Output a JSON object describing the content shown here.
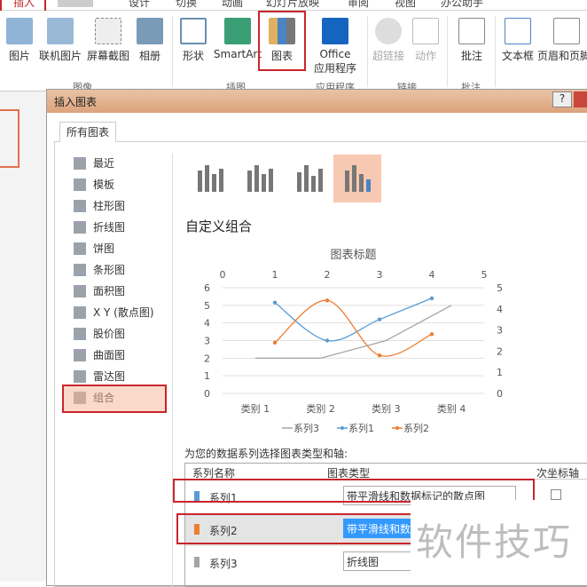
{
  "ribbon_tabs": [
    "插入",
    "设计",
    "切换",
    "动画",
    "幻灯片放映",
    "审阅",
    "视图",
    "办公助手"
  ],
  "ribbon_buttons": [
    "图片",
    "联机图片",
    "屏幕截图",
    "相册",
    "形状",
    "SmartArt",
    "图表",
    "Office\n应用程序",
    "超链接",
    "动作",
    "批注",
    "文本框",
    "页眉和页脚"
  ],
  "ribbon_groups": [
    "图像",
    "插图",
    "应用程序",
    "链接",
    "批注"
  ],
  "dialog": {
    "title": "插入图表",
    "help": "?",
    "tab": "所有图表",
    "categories": [
      "最近",
      "模板",
      "柱形图",
      "折线图",
      "饼图",
      "条形图",
      "面积图",
      "X Y (散点图)",
      "股价图",
      "曲面图",
      "雷达图",
      "组合"
    ],
    "selected_category": "组合",
    "heading": "自定义组合",
    "series_prompt": "为您的数据系列选择图表类型和轴:",
    "table_headers": [
      "系列名称",
      "图表类型",
      "次坐标轴"
    ],
    "rows": [
      {
        "name": "系列1",
        "type": "带平滑线和数据标记的散点图",
        "color": "#5b9bd5"
      },
      {
        "name": "系列2",
        "type": "带平滑线和数",
        "color": "#ed7d31"
      },
      {
        "name": "系列3",
        "type": "折线图",
        "color": "#a5a5a5"
      }
    ]
  },
  "watermark": "软件技巧",
  "chart_data": {
    "type": "combo",
    "title": "图表标题",
    "categories": [
      "类别 1",
      "类别 2",
      "类别 3",
      "类别 4"
    ],
    "left_axis": {
      "range": [
        0,
        6
      ],
      "ticks": [
        "0",
        "1",
        "2",
        "3",
        "4",
        "5",
        "6"
      ]
    },
    "right_axis": {
      "range": [
        0,
        5
      ],
      "ticks": [
        "0",
        "1",
        "2",
        "3",
        "4",
        "5"
      ]
    },
    "top_axis": {
      "range": [
        0,
        5
      ],
      "ticks": [
        "0",
        "1",
        "2",
        "3",
        "4",
        "5"
      ]
    },
    "series": [
      {
        "name": "系列3",
        "type": "line",
        "axis": "left",
        "color": "#a5a5a5",
        "values": [
          2,
          2,
          3,
          5
        ]
      },
      {
        "name": "系列1",
        "type": "scatter-smooth",
        "axis": "right",
        "color": "#5b9bd5",
        "x": [
          1,
          2,
          3,
          4
        ],
        "values": [
          4.3,
          2.5,
          3.5,
          4.5
        ]
      },
      {
        "name": "系列2",
        "type": "scatter-smooth",
        "axis": "right",
        "color": "#ed7d31",
        "x": [
          1,
          2,
          3,
          4
        ],
        "values": [
          2.4,
          4.4,
          1.8,
          2.8
        ]
      }
    ],
    "legend": "bottom"
  }
}
